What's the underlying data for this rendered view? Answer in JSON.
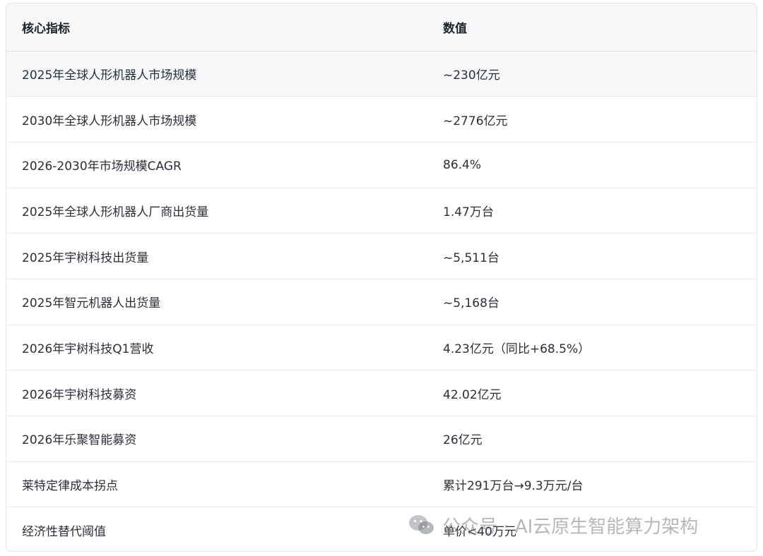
{
  "table": {
    "headers": [
      "核心指标",
      "数值"
    ],
    "rows": [
      [
        "2025年全球人形机器人市场规模",
        "~230亿元"
      ],
      [
        "2030年全球人形机器人市场规模",
        "~2776亿元"
      ],
      [
        "2026-2030年市场规模CAGR",
        "86.4%"
      ],
      [
        "2025年全球人形机器人厂商出货量",
        "1.47万台"
      ],
      [
        "2025年宇树科技出货量",
        "~5,511台"
      ],
      [
        "2025年智元机器人出货量",
        "~5,168台"
      ],
      [
        "2026年宇树科技Q1营收",
        "4.23亿元（同比+68.5%）"
      ],
      [
        "2026年宇树科技募资",
        "42.02亿元"
      ],
      [
        "2026年乐聚智能募资",
        "26亿元"
      ],
      [
        "莱特定律成本拐点",
        "累计291万台→9.3万元/台"
      ],
      [
        "经济性替代阈值",
        "单价<40万元"
      ]
    ]
  },
  "watermark": {
    "text": "公众号 · AI云原生智能算力架构",
    "icon": "wechat-icon"
  }
}
